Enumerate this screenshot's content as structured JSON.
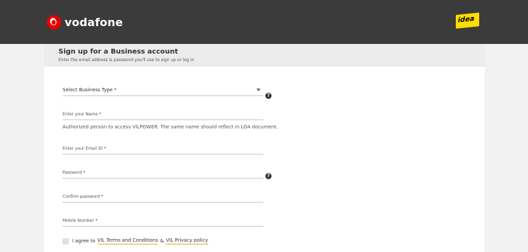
{
  "header": {
    "brand_name": "vodafone",
    "partner_logo_text": "idea",
    "colors": {
      "header_bg": "#3b3b3b",
      "brand_red": "#e60000",
      "idea_yellow": "#ffdd00"
    }
  },
  "page": {
    "title": "Sign up for a Business account",
    "subtitle": "Enter the email address & password you'll use to sign up or log in"
  },
  "form": {
    "business_type": {
      "placeholder": "Select Business Type",
      "required_mark": "*"
    },
    "name": {
      "label": "Enter your Name",
      "required_mark": "*",
      "hint": "Authorized person to access VILPOWER. The same name should reflect in LOA document."
    },
    "email": {
      "label": "Enter your Email ID",
      "required_mark": "*"
    },
    "password": {
      "label": "Password",
      "required_mark": "*"
    },
    "confirm_password": {
      "label": "Confirm password",
      "required_mark": "*"
    },
    "mobile": {
      "label": "Mobile Number",
      "required_mark": "*"
    },
    "agree": {
      "prefix": "I agree to",
      "terms_link": "VIL Terms and Conditions",
      "connector": "&",
      "privacy_link": "VIL Privacy policy"
    },
    "help_glyph": "?"
  }
}
